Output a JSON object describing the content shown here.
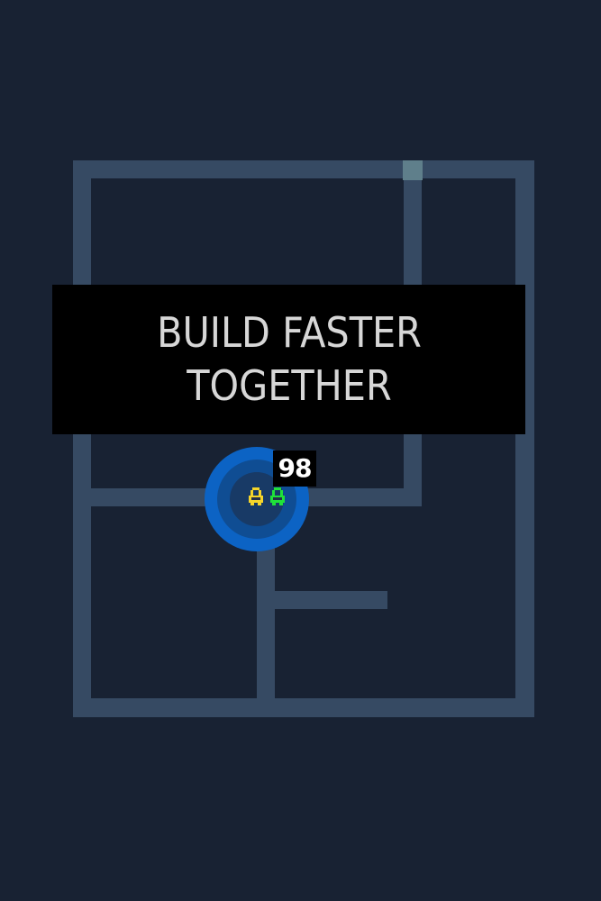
{
  "banner": {
    "title": "BUILD FASTER TOGETHER"
  },
  "hud": {
    "score": "98"
  },
  "players": [
    {
      "name": "yellow-player",
      "color": "#f5d52a"
    },
    {
      "name": "green-player",
      "color": "#1fe23a"
    }
  ],
  "colors": {
    "background": "#182233",
    "wall": "#364a63",
    "exit_tile": "#5f7f8b",
    "ring_outer": "#0c63c4",
    "ring_mid": "#0f4d93",
    "ring_inner": "#183a66",
    "banner_bg": "#000000",
    "banner_text": "#d7d7d7"
  }
}
